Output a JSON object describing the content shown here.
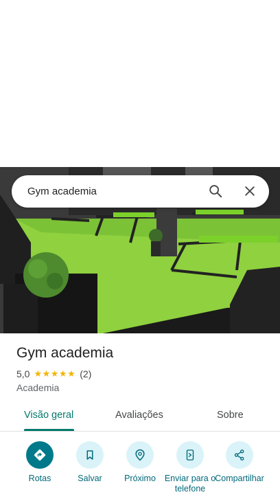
{
  "search": {
    "query": "Gym academia"
  },
  "place": {
    "name": "Gym academia",
    "rating": "5,0",
    "stars": "★★★★★",
    "review_count": "(2)",
    "category": "Academia"
  },
  "tabs": [
    {
      "label": "Visão geral",
      "selected": true
    },
    {
      "label": "Avaliações",
      "selected": false
    },
    {
      "label": "Sobre",
      "selected": false
    }
  ],
  "actions": [
    {
      "label": "Rotas",
      "icon": "directions-icon"
    },
    {
      "label": "Salvar",
      "icon": "bookmark-icon"
    },
    {
      "label": "Próximo",
      "icon": "nearby-icon"
    },
    {
      "label": "Enviar para o telefone",
      "icon": "send-to-phone-icon"
    },
    {
      "label": "Compartilhar",
      "icon": "share-icon"
    }
  ],
  "colors": {
    "accent": "#00796b",
    "action_primary": "#00798a",
    "action_bg": "#d9f3f8",
    "star": "#f4b400"
  }
}
